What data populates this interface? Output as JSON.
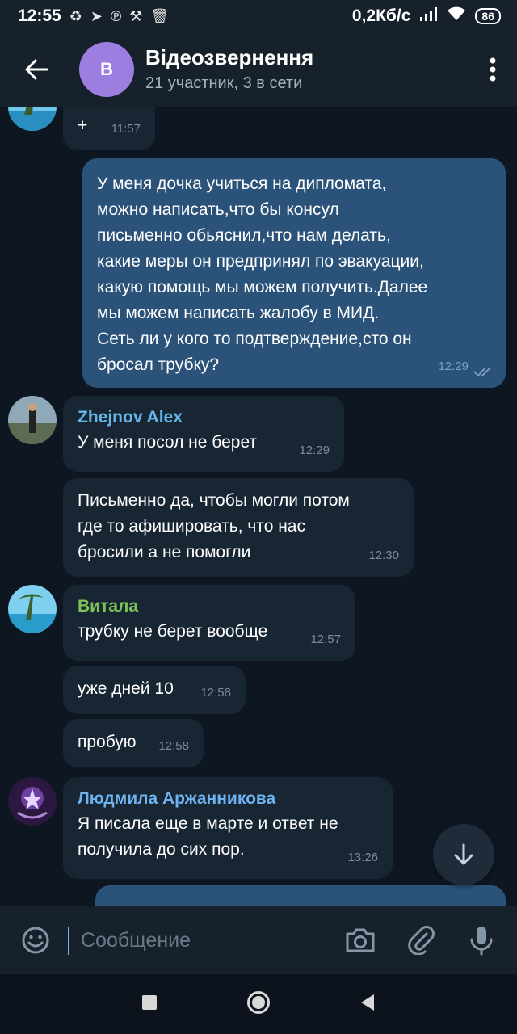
{
  "status_bar": {
    "time": "12:55",
    "net_speed": "0,2Кб/с",
    "battery": "86",
    "icons": [
      "recycle-icon",
      "telegram-icon",
      "pinterest-icon",
      "tools-icon",
      "trash-icon",
      "signal-icon",
      "wifi-icon",
      "battery-icon"
    ]
  },
  "header": {
    "avatar_letter": "В",
    "title": "Відеозвернення",
    "subtitle": "21 участник, 3 в сети",
    "colors": {
      "avatar": "#9b7ee0",
      "bar": "#17212b"
    }
  },
  "messages": [
    {
      "id": "m0",
      "direction": "in",
      "text": "+",
      "time": "11:57"
    },
    {
      "id": "m1",
      "direction": "out",
      "lines": [
        "У меня дочка  учиться на дипломата,",
        "можно написать,что бы  консул",
        "письменно  обьяснил,что нам делать,",
        "какие меры он предпринял по эвакуации,",
        "какую помощь мы можем получить.Далее",
        "мы можем написать жалобу в МИД.",
        "Сеть ли у кого то подтверждение,сто он",
        "бросал трубку?"
      ],
      "time": "12:29",
      "read": true
    },
    {
      "id": "m2",
      "direction": "in",
      "sender": "Zhejnov Alex",
      "sender_color": "#64b5e8",
      "text": "У меня посол не берет",
      "time": "12:29"
    },
    {
      "id": "m3",
      "direction": "in",
      "lines": [
        "Письменно да, чтобы могли потом",
        "где то афишировать, что нас",
        "бросили а не помогли"
      ],
      "time": "12:30"
    },
    {
      "id": "m4",
      "direction": "in",
      "sender": "Витала",
      "sender_color": "#7cc35a",
      "text": "трубку не берет вообще",
      "time": "12:57"
    },
    {
      "id": "m5",
      "direction": "in",
      "text": "уже дней 10",
      "time": "12:58"
    },
    {
      "id": "m6",
      "direction": "in",
      "text": "пробую",
      "time": "12:58"
    },
    {
      "id": "m7",
      "direction": "in",
      "sender": "Людмила Аржанникова",
      "sender_color": "#6eb2f0",
      "lines": [
        "Я писала еще в марте и ответ не",
        "получила до сих пор."
      ],
      "time": "13:26"
    }
  ],
  "input": {
    "placeholder": "Сообщение"
  },
  "colors": {
    "background": "#0e1621",
    "bubble_in": "#182533",
    "bubble_out": "#2b5278",
    "accent": "#6fb4f0"
  }
}
